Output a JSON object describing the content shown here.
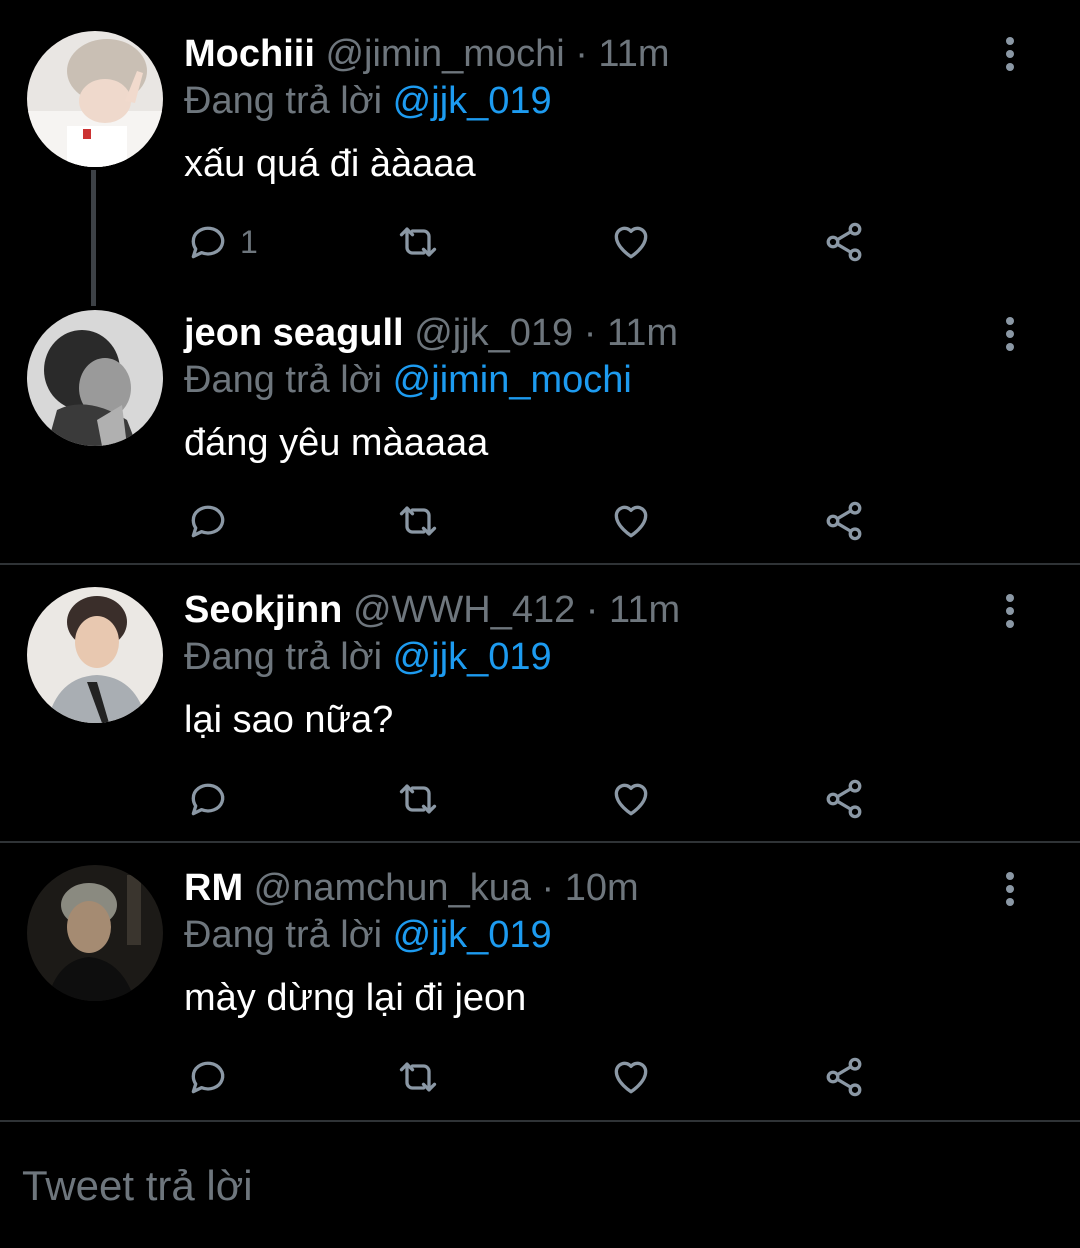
{
  "tweets": [
    {
      "name": "Mochiii",
      "handle": "@jimin_mochi",
      "time": "· 11m",
      "reply_prefix": "Đang trả lời ",
      "reply_to": "@jjk_019",
      "text": "xấu quá đi ààaaa",
      "reply_count": "1"
    },
    {
      "name": "jeon seagull",
      "handle": "@jjk_019",
      "time": "· 11m",
      "reply_prefix": "Đang trả lời ",
      "reply_to": "@jimin_mochi",
      "text": "đáng yêu màaaaa",
      "reply_count": ""
    },
    {
      "name": "Seokjinn",
      "handle": "@WWH_412",
      "time": "· 11m",
      "reply_prefix": "Đang trả lời ",
      "reply_to": "@jjk_019",
      "text": "lại sao nữa?",
      "reply_count": ""
    },
    {
      "name": "RM",
      "handle": "@namchun_kua",
      "time": "· 10m",
      "reply_prefix": "Đang trả lời ",
      "reply_to": "@jjk_019",
      "text": "mày dừng lại đi jeon",
      "reply_count": ""
    }
  ],
  "compose": {
    "placeholder": "Tweet trả lời"
  },
  "icons": {
    "reply": "reply-icon",
    "retweet": "retweet-icon",
    "like": "heart-icon",
    "share": "share-icon",
    "more": "more-vertical-icon"
  },
  "colors": {
    "background": "#000000",
    "text": "#ffffff",
    "muted": "#6e767d",
    "accent": "#1d9bf0",
    "divider": "#2f3336"
  }
}
